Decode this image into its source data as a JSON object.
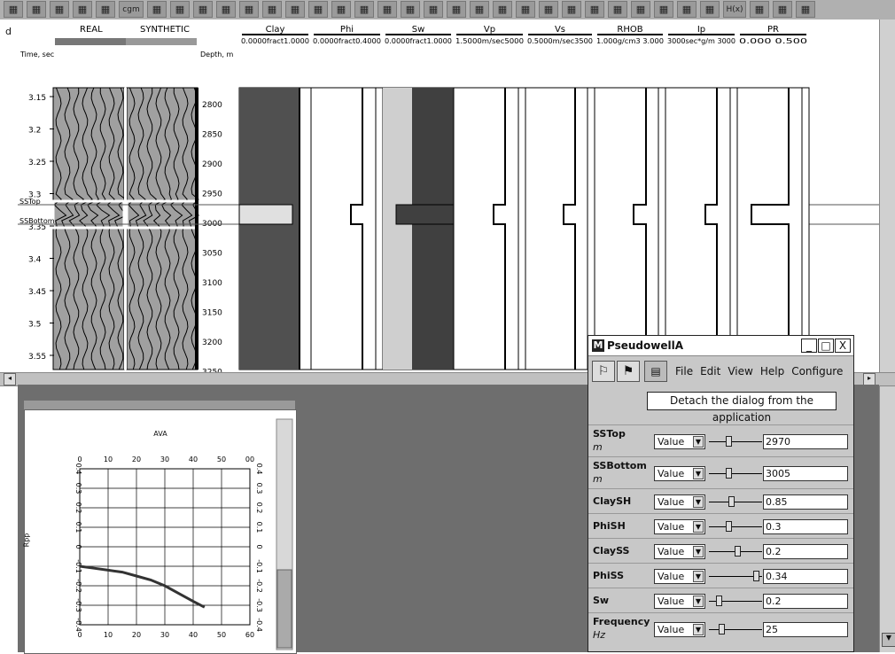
{
  "toolbar": {
    "buttons": [
      "graph-icon",
      "book-icon",
      "person-icon",
      "chart-icon",
      "disk-icon",
      "cgm-label",
      "grid-icon",
      "grid2-icon",
      "grid3-icon",
      "list-icon",
      "panel-icon",
      "block-icon",
      "map-icon",
      "select-icon",
      "lasso-icon",
      "shape-icon",
      "tool-icon",
      "cross-icon",
      "brush-icon",
      "table-icon",
      "panel2-icon",
      "chart2-icon",
      "pointer-icon",
      "axis-icon",
      "zoom-in-icon",
      "zoom-out-icon",
      "zoom-icon",
      "zoom-fit-icon",
      "cursor-icon",
      "pen-icon",
      "measure-icon",
      "hx-icon",
      "db-icon",
      "split-icon",
      "arrange-icon"
    ],
    "cgm_label": "cgm",
    "hx_label": "H(x)"
  },
  "left_marker": "d",
  "seismic": {
    "real_label": "REAL",
    "synthetic_label": "SYNTHETIC",
    "time_label": "Time, sec",
    "depth_label": "Depth, m",
    "time_ticks": [
      "3.15",
      "3.2",
      "3.25",
      "3.3",
      "3.35",
      "3.4",
      "3.45",
      "3.5",
      "3.55"
    ],
    "depth_ticks": [
      "2800",
      "2850",
      "2900",
      "2950",
      "3000",
      "3050",
      "3100",
      "3150",
      "3200",
      "3250"
    ],
    "sstop_label": "SSTop",
    "ssbottom_label": "SSBottom"
  },
  "logs": [
    {
      "name": "Clay",
      "range": "0.0000fract1.0000"
    },
    {
      "name": "Phi",
      "range": "0.0000fract0.4000"
    },
    {
      "name": "Sw",
      "range": "0.0000fract1.0000"
    },
    {
      "name": "Vp",
      "range": "1.5000m/sec5000"
    },
    {
      "name": "Vs",
      "range": "0.5000m/sec3500"
    },
    {
      "name": "RHOB",
      "range": "1.000g/cm3 3.000"
    },
    {
      "name": "Ip",
      "range": "3000sec*g/m 3000"
    },
    {
      "name": "PR",
      "range": "0.000      0.500"
    }
  ],
  "ava": {
    "title": "AVA",
    "ylabel": "Rpp",
    "x_ticks": [
      "0",
      "10",
      "20",
      "30",
      "40",
      "50",
      "60"
    ],
    "top_ticks": [
      "0",
      "10",
      "20",
      "30",
      "40",
      "50",
      "00"
    ],
    "y_ticks": [
      "0.4",
      "0.3",
      "0.2",
      "0.1",
      "0",
      "-0.1",
      "-0.2",
      "-0.3",
      "-0.4"
    ]
  },
  "pseudowell": {
    "title": "PseudowellA",
    "logo": "M",
    "menu": [
      "File",
      "Edit",
      "View",
      "Help",
      "Configure"
    ],
    "tooltip": "Detach the dialog from the application",
    "minimize": "_",
    "maximize": "□",
    "close": "X",
    "params": [
      {
        "name": "SSTop",
        "unit": "m",
        "mode": "Value",
        "value": "2970",
        "slider": 0.35
      },
      {
        "name": "SSBottom",
        "unit": "m",
        "mode": "Value",
        "value": "3005",
        "slider": 0.35
      },
      {
        "name": "ClaySH",
        "unit": "",
        "mode": "Value",
        "value": "0.85",
        "slider": 0.42
      },
      {
        "name": "PhiSH",
        "unit": "",
        "mode": "Value",
        "value": "0.3",
        "slider": 0.35
      },
      {
        "name": "ClaySS",
        "unit": "",
        "mode": "Value",
        "value": "0.2",
        "slider": 0.55
      },
      {
        "name": "PhiSS",
        "unit": "",
        "mode": "Value",
        "value": "0.34",
        "slider": 0.95
      },
      {
        "name": "Sw",
        "unit": "",
        "mode": "Value",
        "value": "0.2",
        "slider": 0.15
      },
      {
        "name": "Frequency",
        "unit": "Hz",
        "mode": "Value",
        "value": "25",
        "slider": 0.2
      }
    ]
  }
}
